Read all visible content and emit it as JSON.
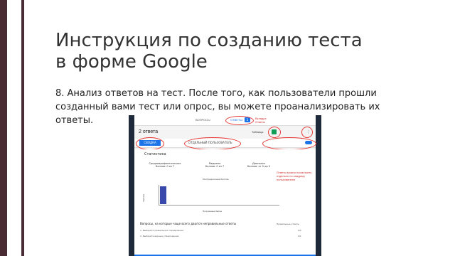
{
  "slide": {
    "title_line1": "Инструкция по созданию теста",
    "title_line2": "в форме Google",
    "body": "8. Анализ ответов на тест. После того, как пользователи прошли созданный вами тест или опрос, вы можете проанализировать их ответы."
  },
  "screenshot": {
    "tabs": [
      "ВОПРОСЫ",
      "ОТВЕТЫ"
    ],
    "responses_badge": "2",
    "heading": "2 ответа",
    "sheets_label": "Таблицы",
    "summary_button": "СВОДКА",
    "individual_button": "ОТДЕЛЬНЫЙ ПОЛЬЗОВАТЕЛЬ",
    "stats_title": "Статистика",
    "columns": [
      {
        "label": "Среднеарифметическое",
        "value": "Баллов: 0 из 7"
      },
      {
        "label": "Медиана",
        "value": "Баллов: 0 из 7"
      },
      {
        "label": "Диапазон",
        "value": "Баллов: от 0 до 0"
      }
    ],
    "chart_title": "Распределение баллов",
    "y_label": "Частота",
    "x_label": "Полученные баллы",
    "x_ticks": [
      "0",
      "1",
      "2",
      "3",
      "4",
      "5",
      "6",
      "7"
    ],
    "y_ticks": [
      "0",
      "1",
      "2"
    ],
    "questions_heading": "Вопросы, на которые чаще всего даются неправильные ответы",
    "questions_right": "Правильные ответы",
    "questions": [
      {
        "text": "1. Выберите правильное определение",
        "score": "0/2"
      },
      {
        "text": "2. Выберите верные утверждения",
        "score": "0/1"
      }
    ],
    "notes": {
      "responses": "Вкладка Ответы",
      "sheets": "Таблицы",
      "toggle": "Можно прекратить принимать ответы",
      "stats": "Ответы можно посмотреть отдельно по каждому пользователю"
    }
  },
  "colors": {
    "sidebar": "#4a2b33",
    "accent": "#1a73e8",
    "annotation": "#e53935"
  }
}
